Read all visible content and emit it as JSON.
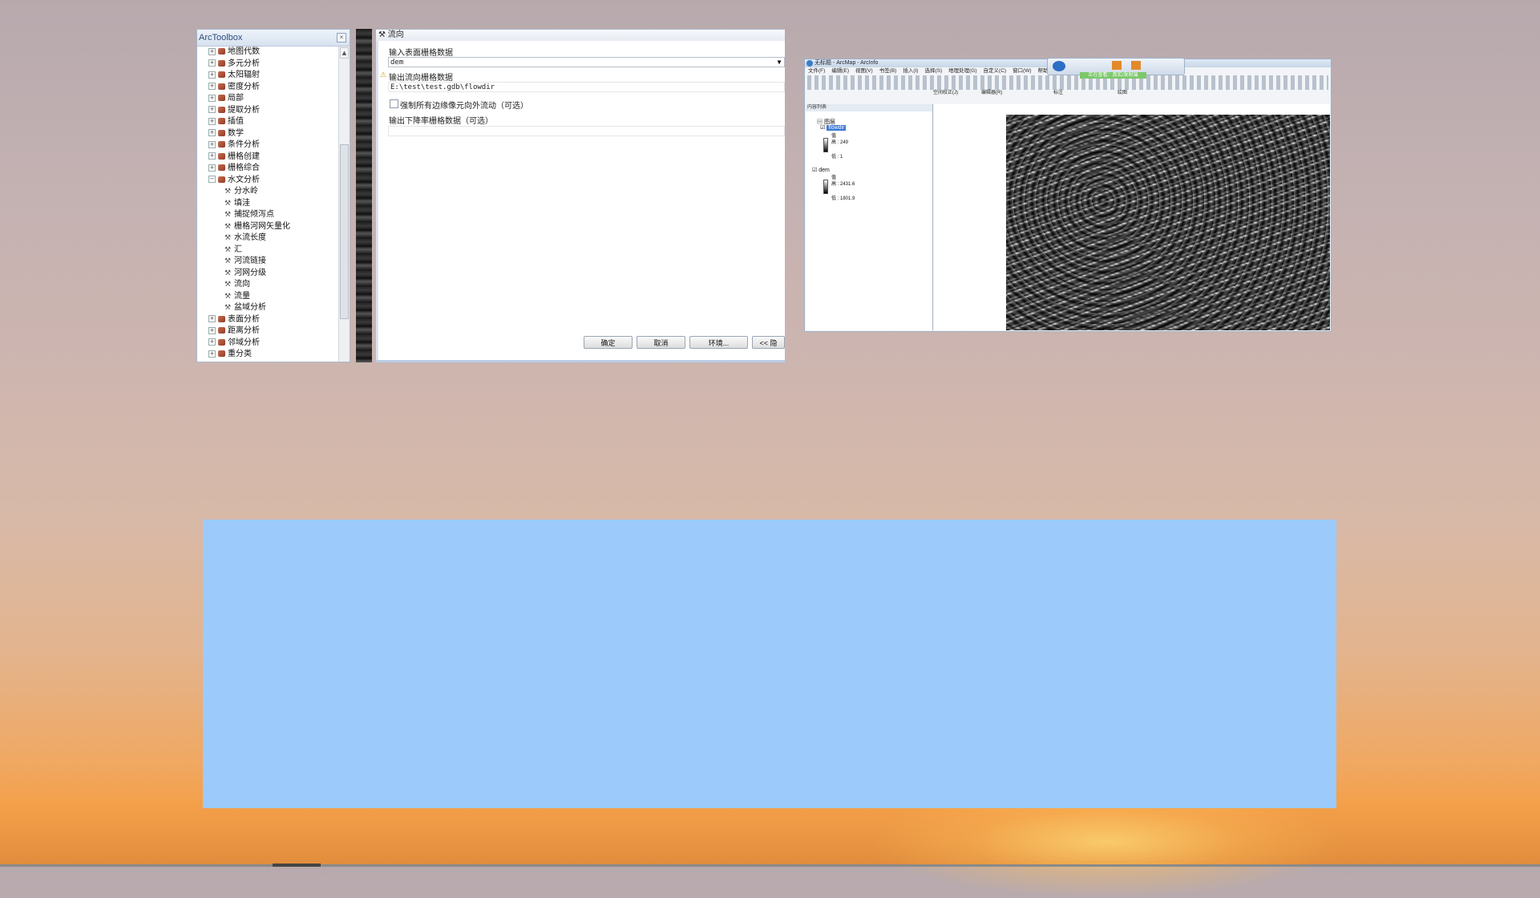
{
  "toolbox": {
    "title": "ArcToolbox",
    "close_symbol": "×",
    "items": [
      {
        "label": "地图代数",
        "type": "toolset",
        "expander": "+"
      },
      {
        "label": "多元分析",
        "type": "toolset",
        "expander": "+"
      },
      {
        "label": "太阳辐射",
        "type": "toolset",
        "expander": "+"
      },
      {
        "label": "密度分析",
        "type": "toolset",
        "expander": "+"
      },
      {
        "label": "局部",
        "type": "toolset",
        "expander": "+"
      },
      {
        "label": "提取分析",
        "type": "toolset",
        "expander": "+"
      },
      {
        "label": "插值",
        "type": "toolset",
        "expander": "+"
      },
      {
        "label": "数学",
        "type": "toolset",
        "expander": "+"
      },
      {
        "label": "条件分析",
        "type": "toolset",
        "expander": "+"
      },
      {
        "label": "栅格创建",
        "type": "toolset",
        "expander": "+"
      },
      {
        "label": "栅格综合",
        "type": "toolset",
        "expander": "+"
      },
      {
        "label": "水文分析",
        "type": "toolset",
        "expander": "−"
      },
      {
        "label": "分水岭",
        "type": "tool"
      },
      {
        "label": "填洼",
        "type": "tool"
      },
      {
        "label": "捕捉倾泻点",
        "type": "tool"
      },
      {
        "label": "栅格河网矢量化",
        "type": "tool"
      },
      {
        "label": "水流长度",
        "type": "tool"
      },
      {
        "label": "汇",
        "type": "tool"
      },
      {
        "label": "河流链接",
        "type": "tool"
      },
      {
        "label": "河网分级",
        "type": "tool"
      },
      {
        "label": "流向",
        "type": "tool"
      },
      {
        "label": "流量",
        "type": "tool"
      },
      {
        "label": "盆域分析",
        "type": "tool"
      },
      {
        "label": "表面分析",
        "type": "toolset",
        "expander": "+"
      },
      {
        "label": "距离分析",
        "type": "toolset",
        "expander": "+"
      },
      {
        "label": "邻域分析",
        "type": "toolset",
        "expander": "+"
      },
      {
        "label": "重分类",
        "type": "toolset",
        "expander": "+"
      }
    ]
  },
  "dialog": {
    "title": "流向",
    "input_label": "输入表面栅格数据",
    "input_value": "dem",
    "output_label": "输出流向栅格数据",
    "output_value": "E:\\test\\test.gdb\\flowdir",
    "checkbox_label": "强制所有边缘像元向外流动（可选）",
    "drop_label": "输出下降率栅格数据（可选）",
    "buttons": {
      "ok": "确定",
      "cancel": "取消",
      "env": "环境...",
      "more": "<< 隐"
    }
  },
  "arcmap": {
    "title": "无标题 - ArcMap - ArcInfo",
    "menu": [
      "文件(F)",
      "编辑(E)",
      "视图(V)",
      "书签(B)",
      "插入(I)",
      "选择(S)",
      "地理处理(G)",
      "自定义(C)",
      "窗口(W)",
      "帮助"
    ],
    "toolbar_labels": {
      "spatial_adjust": "空间校正(J)",
      "editor": "编辑器(R)",
      "label": "标注",
      "draw": "绘图"
    },
    "toc": {
      "header": "内容列表",
      "group": "图层",
      "layers": [
        {
          "name": "flowdir",
          "value_label": "值",
          "high": "高 : 249",
          "low": "低 : 1",
          "selected": true
        },
        {
          "name": "dem",
          "value_label": "值",
          "high": "高 : 2431.6",
          "low": "低 : 1801.9",
          "selected": false
        }
      ]
    },
    "floating_label": "正在查看：真实/发射端"
  }
}
